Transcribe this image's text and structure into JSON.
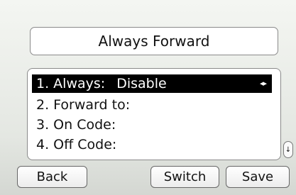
{
  "title": "Always Forward",
  "menu": {
    "items": [
      {
        "label": "1. Always:",
        "value": "Disable",
        "selected": true
      },
      {
        "label": "2. Forward to:",
        "value": ""
      },
      {
        "label": "3. On Code:",
        "value": ""
      },
      {
        "label": "4. Off Code:",
        "value": ""
      }
    ],
    "lr_arrows": "◂▸",
    "scroll_indicator": "↓"
  },
  "softkeys": {
    "back": "Back",
    "switch": "Switch",
    "save": "Save"
  }
}
